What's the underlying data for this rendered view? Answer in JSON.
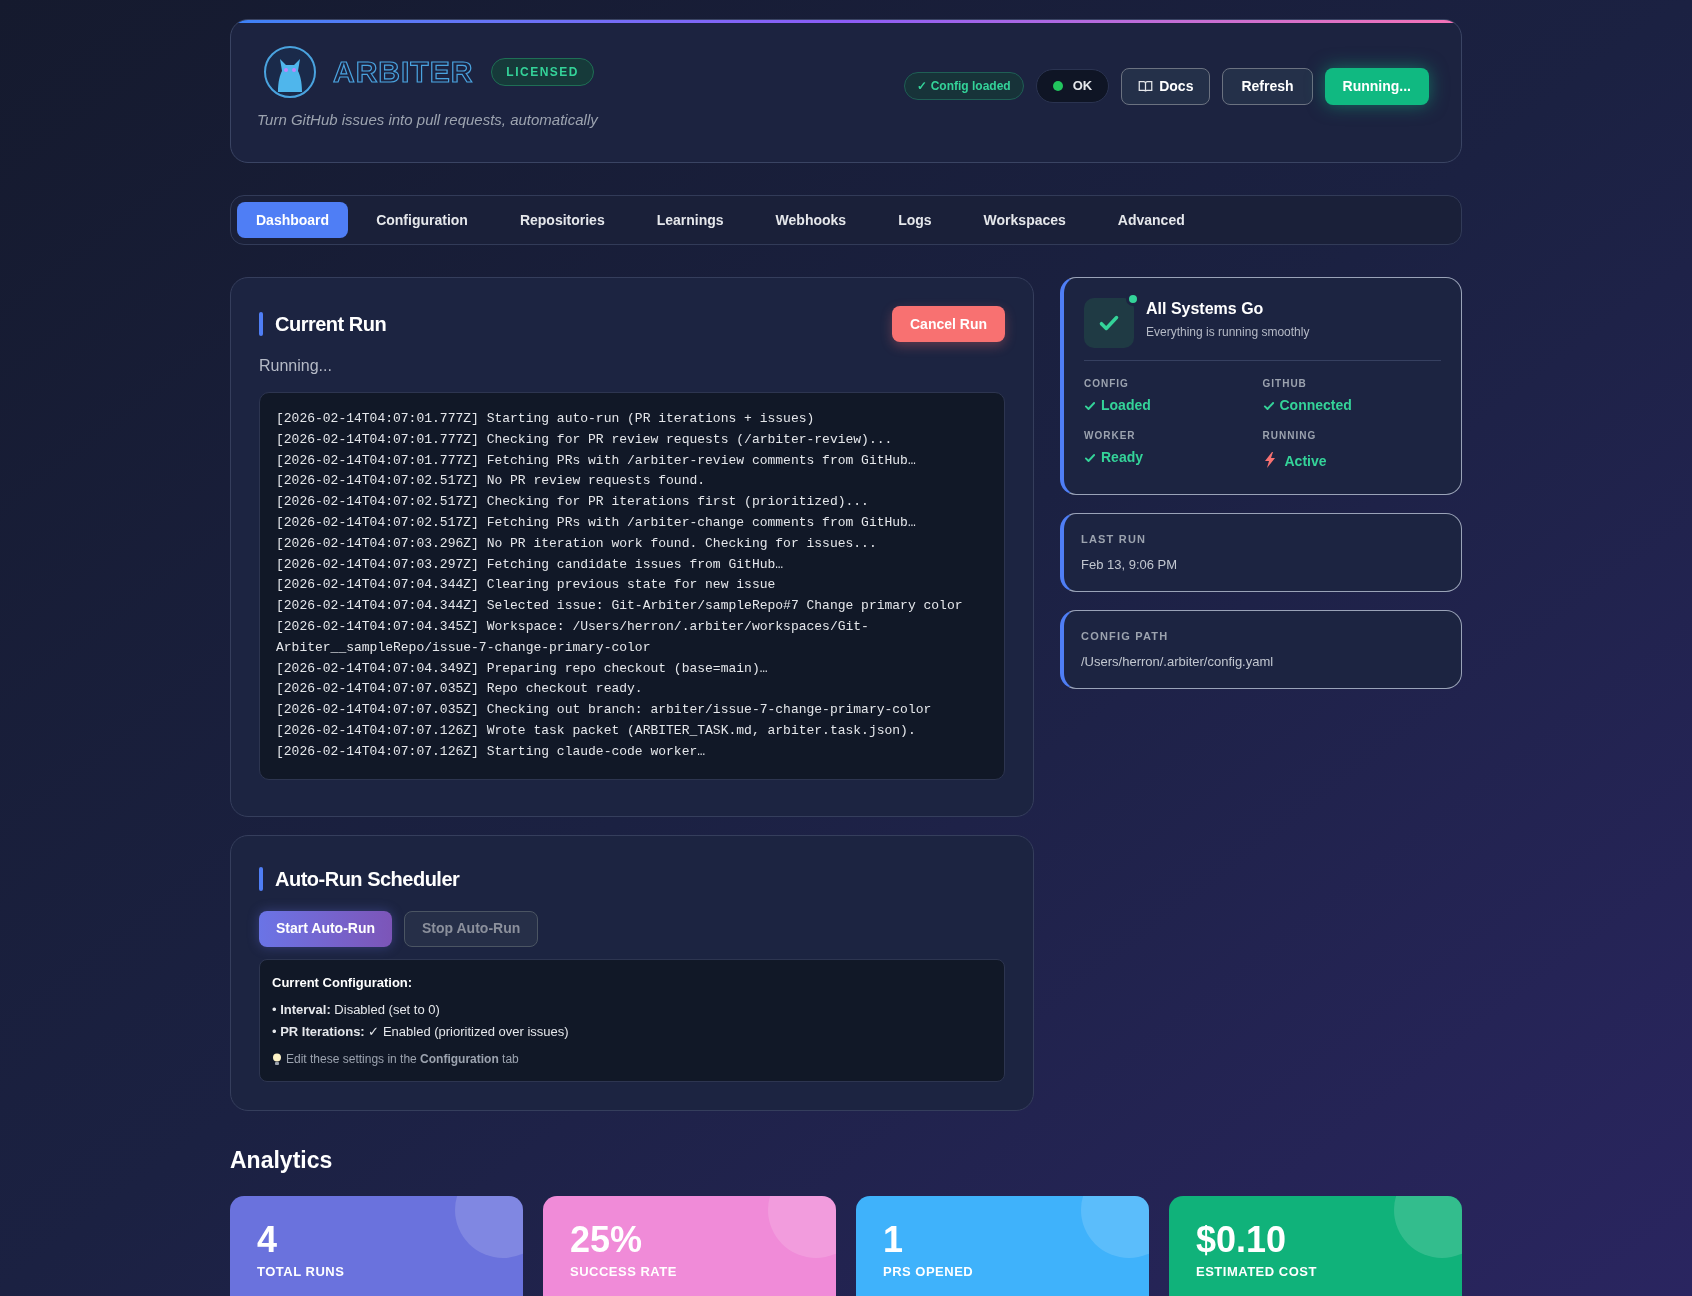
{
  "header": {
    "brand": "ARBITER",
    "license_badge": "LICENSED",
    "tagline": "Turn GitHub issues into pull requests, automatically",
    "config_badge": "✓ Config loaded",
    "status": {
      "label": "OK",
      "color": "#22c55e"
    },
    "buttons": [
      {
        "label": "Docs",
        "kind": "docs"
      },
      {
        "label": "Refresh",
        "kind": "plain"
      },
      {
        "label": "Running...",
        "kind": "primary"
      }
    ]
  },
  "tabs": [
    {
      "label": "Dashboard",
      "selected": true
    },
    {
      "label": "Configuration",
      "selected": false
    },
    {
      "label": "Repositories",
      "selected": false
    },
    {
      "label": "Learnings",
      "selected": false
    },
    {
      "label": "Webhooks",
      "selected": false
    },
    {
      "label": "Logs",
      "selected": false
    },
    {
      "label": "Workspaces",
      "selected": false
    },
    {
      "label": "Advanced",
      "selected": false
    }
  ],
  "current_run": {
    "title": "Current Run",
    "cancel_button": "Cancel Run",
    "status": "Running...",
    "log": [
      "[2026-02-14T04:07:01.777Z] Starting auto-run (PR iterations + issues)",
      "[2026-02-14T04:07:01.777Z] Checking for PR review requests (/arbiter-review)...",
      "[2026-02-14T04:07:01.777Z] Fetching PRs with /arbiter-review comments from GitHub…",
      "[2026-02-14T04:07:02.517Z] No PR review requests found.",
      "[2026-02-14T04:07:02.517Z] Checking for PR iterations first (prioritized)...",
      "[2026-02-14T04:07:02.517Z] Fetching PRs with /arbiter-change comments from GitHub…",
      "[2026-02-14T04:07:03.296Z] No PR iteration work found. Checking for issues...",
      "[2026-02-14T04:07:03.297Z] Fetching candidate issues from GitHub…",
      "[2026-02-14T04:07:04.344Z] Clearing previous state for new issue",
      "[2026-02-14T04:07:04.344Z] Selected issue: Git-Arbiter/sampleRepo#7 Change primary color",
      "[2026-02-14T04:07:04.345Z] Workspace: /Users/herron/.arbiter/workspaces/Git-Arbiter__sampleRepo/issue-7-change-primary-color",
      "[2026-02-14T04:07:04.349Z] Preparing repo checkout (base=main)…",
      "[2026-02-14T04:07:07.035Z] Repo checkout ready.",
      "[2026-02-14T04:07:07.035Z] Checking out branch: arbiter/issue-7-change-primary-color",
      "[2026-02-14T04:07:07.126Z] Wrote task packet (ARBITER_TASK.md, arbiter.task.json).",
      "[2026-02-14T04:07:07.126Z] Starting claude-code worker…"
    ]
  },
  "scheduler": {
    "title": "Auto-Run Scheduler",
    "buttons": [
      {
        "label": "Start Auto-Run",
        "disabled": false
      },
      {
        "label": "Stop Auto-Run",
        "disabled": true
      }
    ],
    "config_title": "Current Configuration:",
    "config_items": [
      "• **Interval:** Disabled (set to 0)",
      "• **PR Iterations:** ✓ Enabled (prioritized over issues)"
    ],
    "tip": "Edit these settings in the **Configuration** tab"
  },
  "system_status": {
    "title": "All Systems Go",
    "subtitle": "Everything is running smoothly",
    "items": [
      {
        "label": "CONFIG",
        "value": "Loaded",
        "kind": "check"
      },
      {
        "label": "GITHUB",
        "value": "Connected",
        "kind": "check"
      },
      {
        "label": "WORKER",
        "value": "Ready",
        "kind": "check"
      },
      {
        "label": "RUNNING",
        "value": "Active",
        "kind": "bolt"
      }
    ]
  },
  "info_cards": [
    {
      "label": "LAST RUN",
      "value": "Feb 13, 9:06 PM"
    },
    {
      "label": "CONFIG PATH",
      "value": "/Users/herron/.arbiter/config.yaml"
    }
  ],
  "analytics": {
    "title": "Analytics",
    "stats": [
      {
        "value": "4",
        "label": "TOTAL RUNS",
        "color": "#6a72dd"
      },
      {
        "value": "25%",
        "label": "SUCCESS RATE",
        "color": "#f08bd8"
      },
      {
        "value": "1",
        "label": "PRS OPENED",
        "color": "#3fb2fb"
      },
      {
        "value": "$0.10",
        "label": "ESTIMATED COST",
        "color": "#10b27a"
      }
    ]
  }
}
